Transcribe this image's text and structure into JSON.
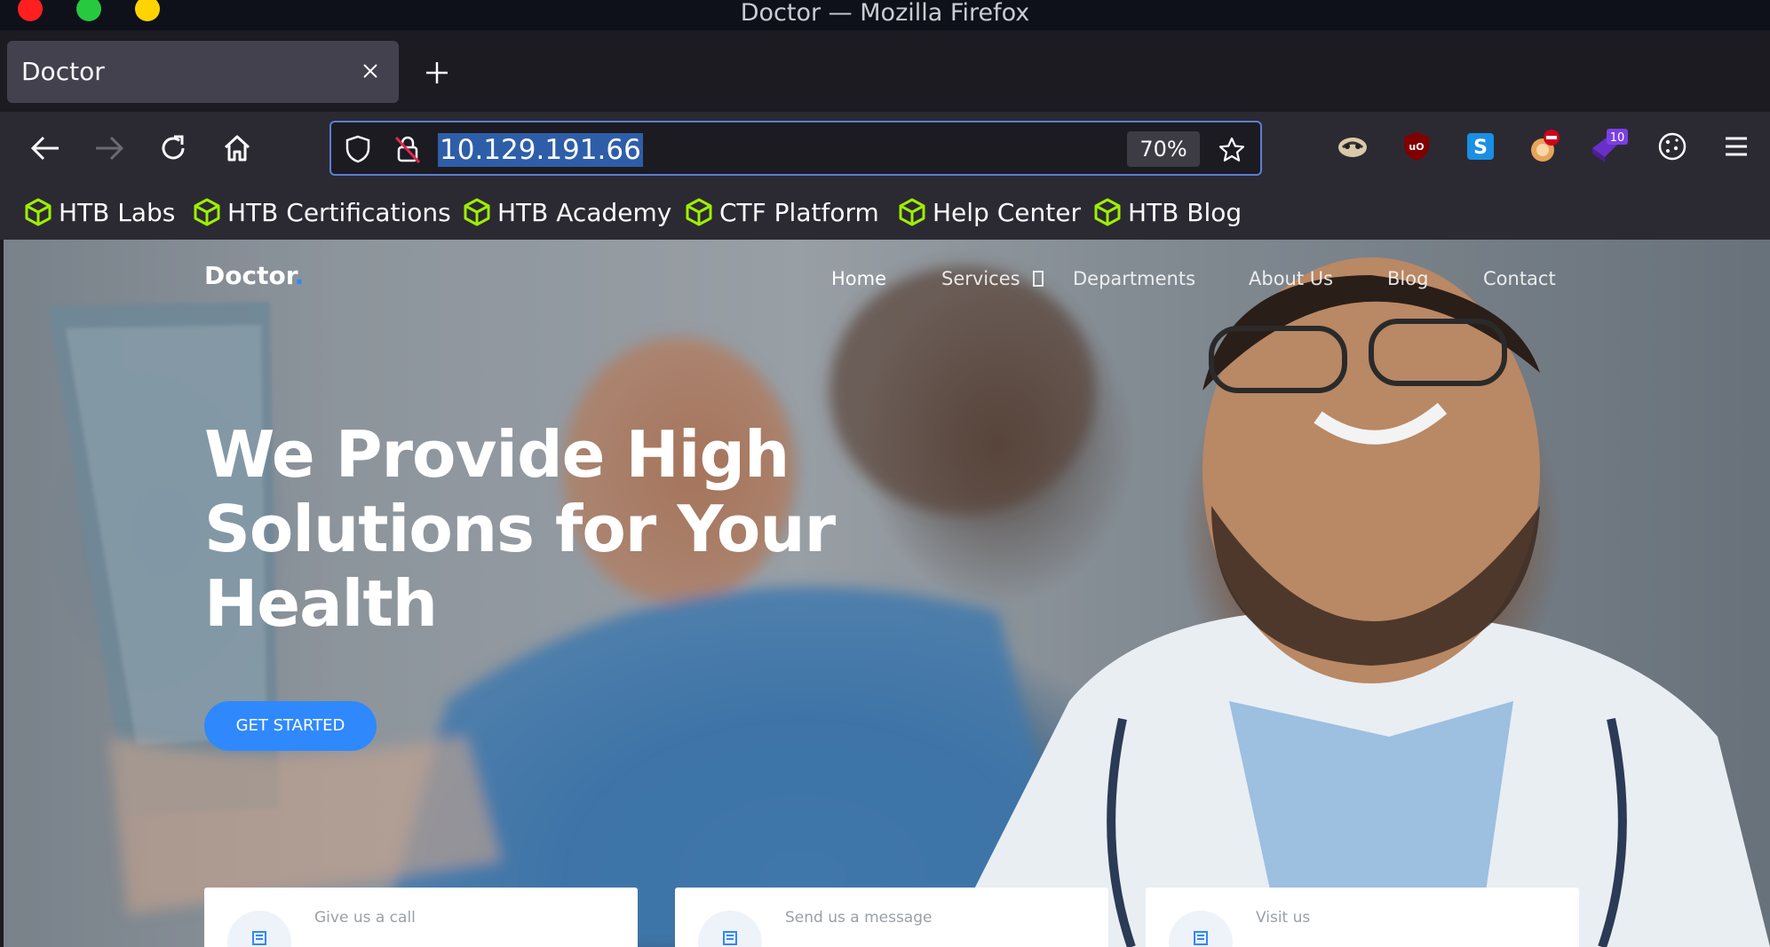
{
  "window": {
    "title": "Doctor — Mozilla Firefox"
  },
  "tab": {
    "title": "Doctor"
  },
  "navbar": {
    "url": "10.129.191.66",
    "zoom": "70%",
    "extension_badge": "10"
  },
  "bookmarks": [
    {
      "label": "HTB Labs"
    },
    {
      "label": "HTB Certifications"
    },
    {
      "label": "HTB Academy"
    },
    {
      "label": "CTF Platform"
    },
    {
      "label": "Help Center"
    },
    {
      "label": "HTB Blog"
    }
  ],
  "site": {
    "logo": "Doctor",
    "logo_dot": ".",
    "nav": [
      "Home",
      "Services",
      "Departments",
      "About Us",
      "Blog",
      "Contact"
    ],
    "hero_title": "We Provide High Solutions for Your Health",
    "cta": "GET STARTED",
    "cards": [
      "Give us a call",
      "Send us a message",
      "Visit us"
    ]
  },
  "colors": {
    "accent": "#2f89fc",
    "url_highlight": "#2e5ea8",
    "bookmark_icon": "#9fef00"
  }
}
